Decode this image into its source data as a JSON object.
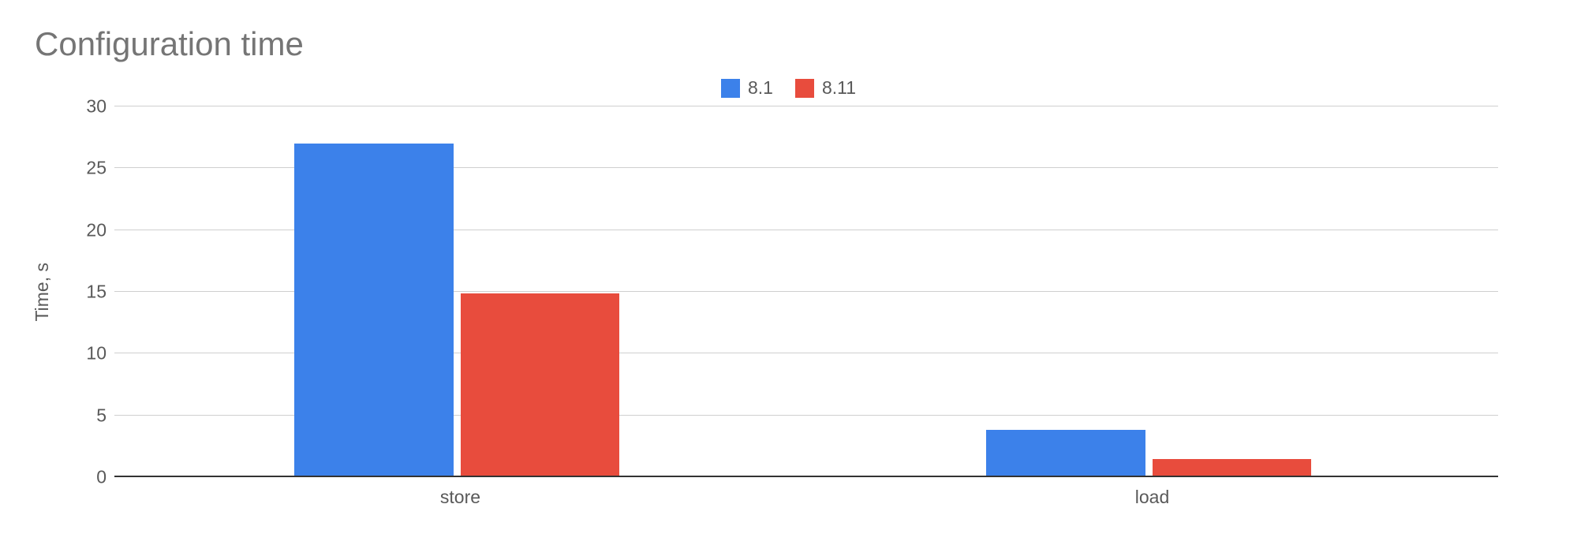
{
  "chart_data": {
    "type": "bar",
    "title": "Configuration time",
    "ylabel": "Time, s",
    "xlabel": "",
    "ylim": [
      0,
      30
    ],
    "yticks": [
      0,
      5,
      10,
      15,
      20,
      25,
      30
    ],
    "categories": [
      "store",
      "load"
    ],
    "series": [
      {
        "name": "8.1",
        "color": "#3C81EA",
        "values": [
          27,
          3.8
        ]
      },
      {
        "name": "8.11",
        "color": "#E84C3D",
        "values": [
          14.9,
          1.5
        ]
      }
    ],
    "legend_position": "top"
  }
}
